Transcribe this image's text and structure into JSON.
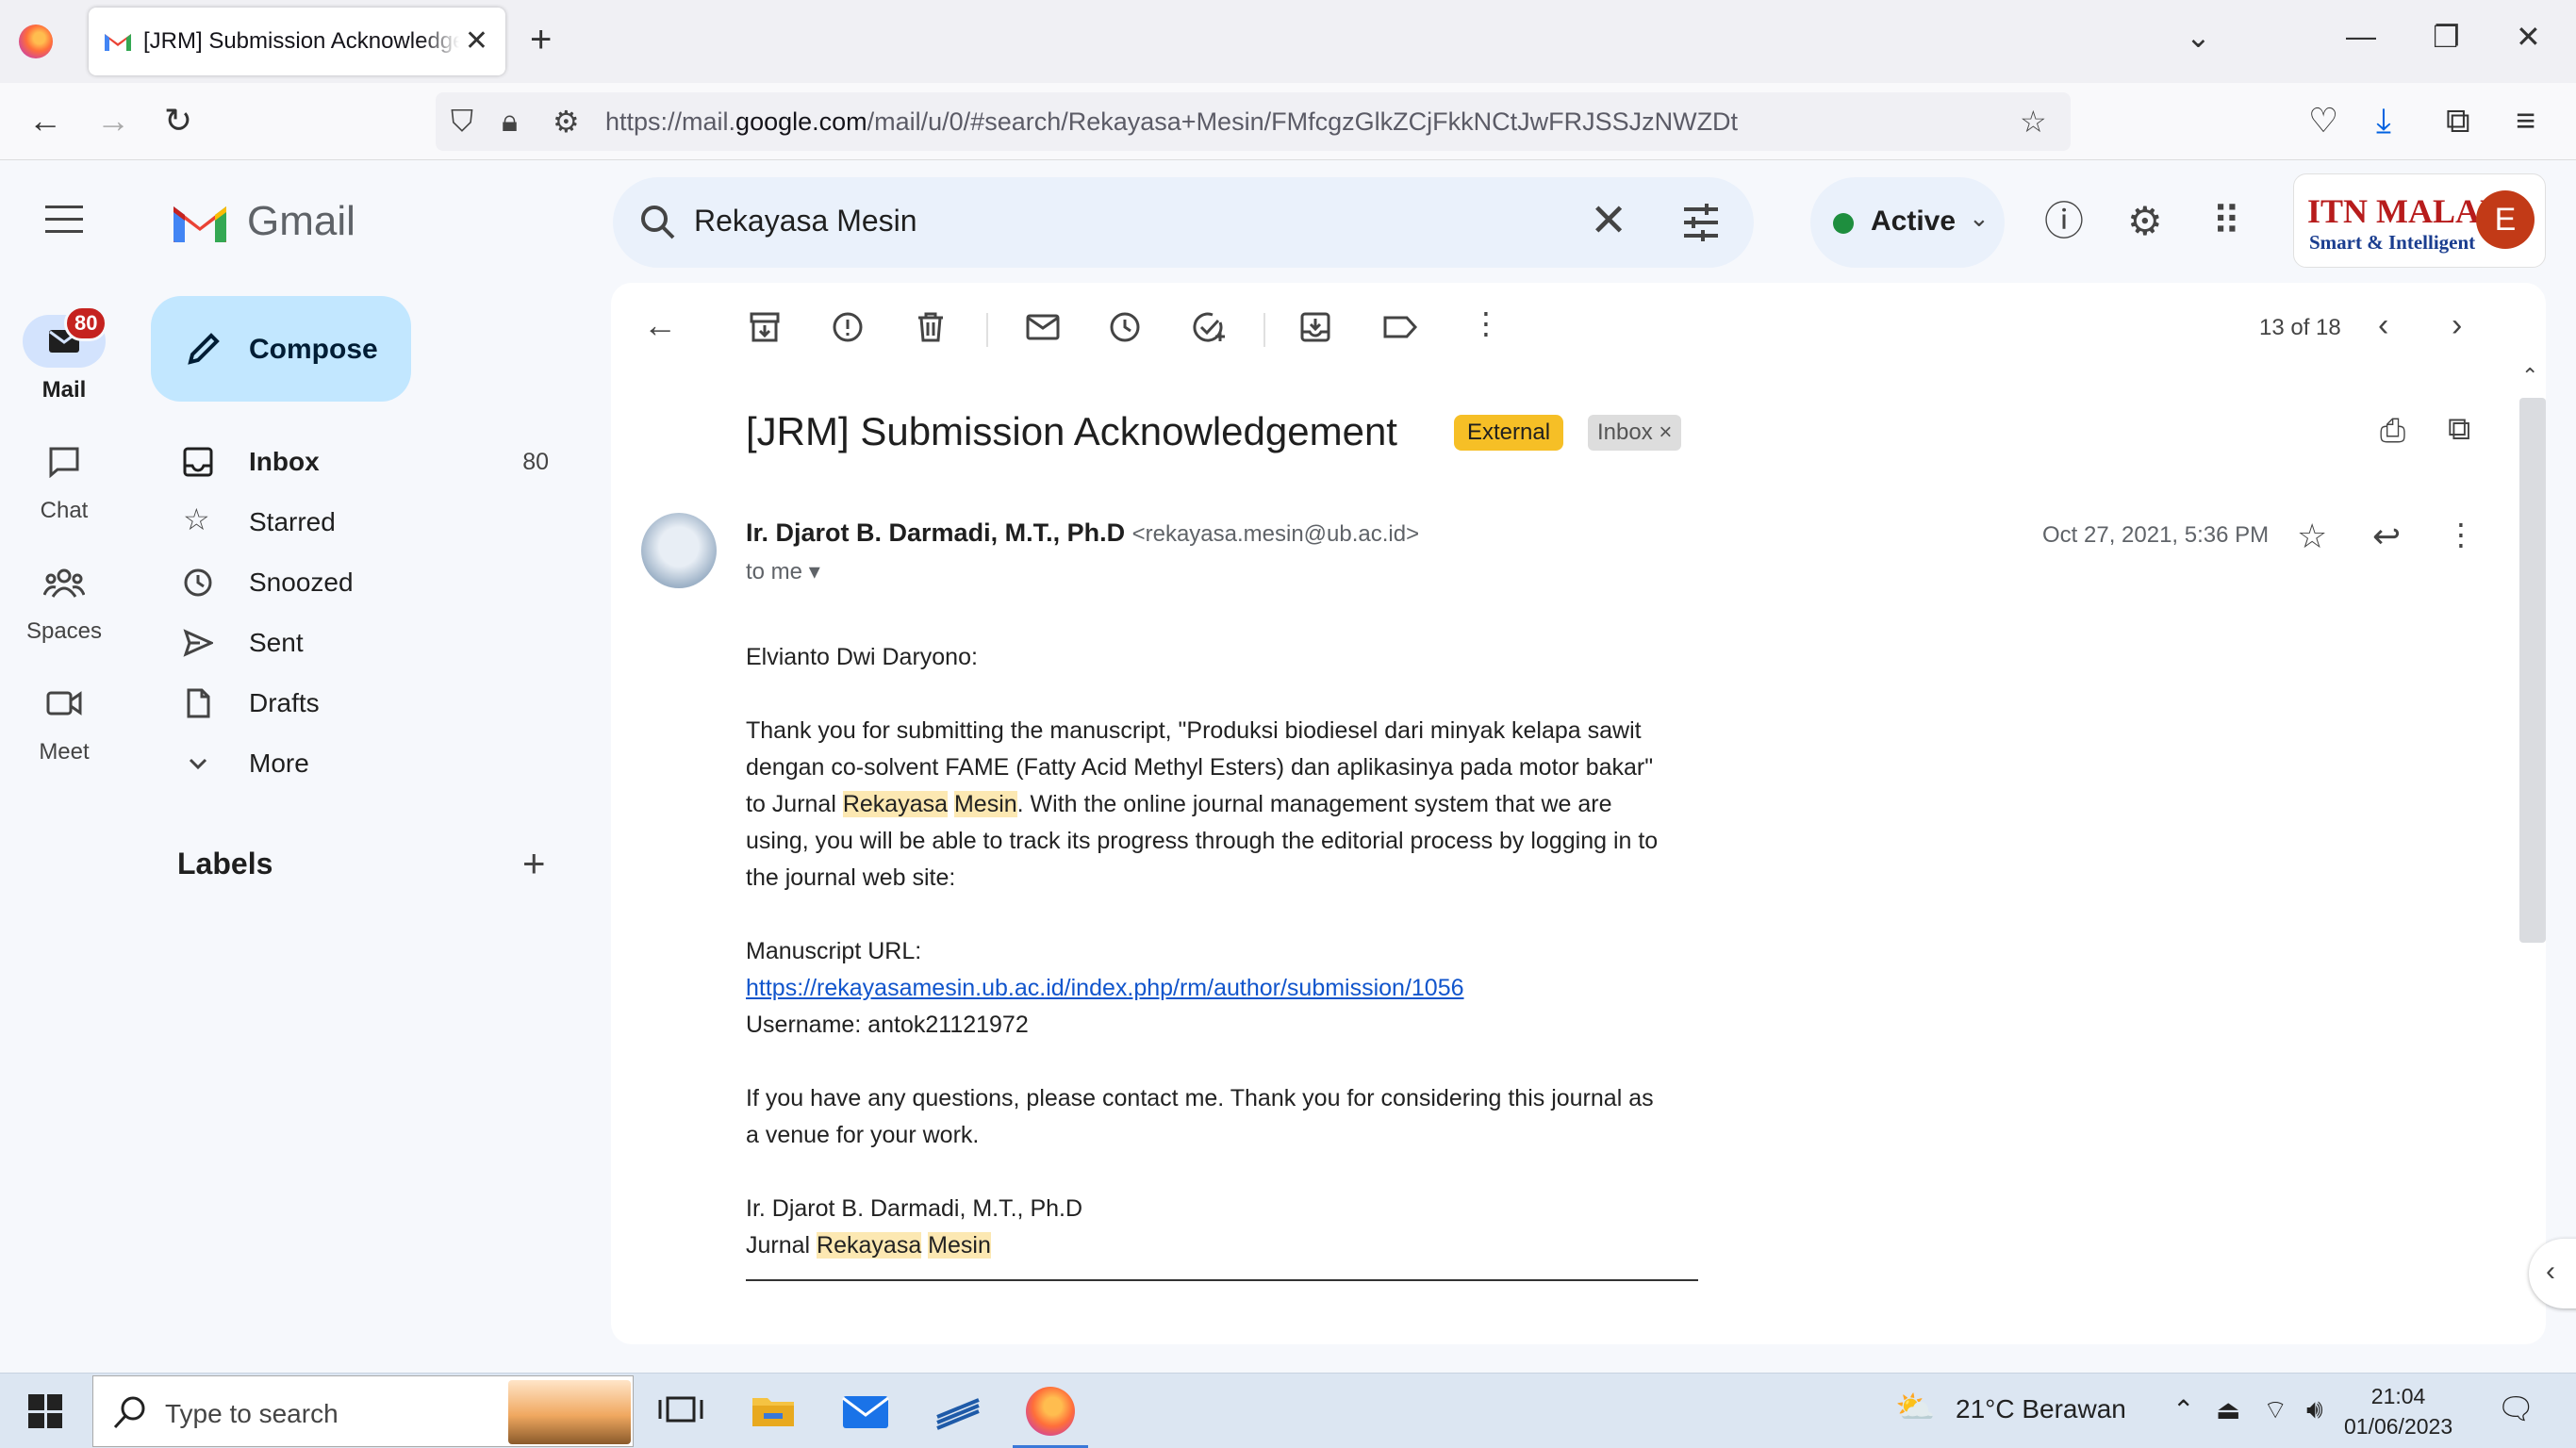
{
  "browser": {
    "tab_title": "[JRM] Submission Acknowledgement",
    "url_prefix": "https://mail.",
    "url_domain": "google.com",
    "url_path": "/mail/u/0/#search/Rekayasa+Mesin/FMfcgzGlkZCjFkkNCtJwFRJSSJzNWZDt"
  },
  "gmail": {
    "app_name": "Gmail",
    "search_query": "Rekayasa Mesin",
    "status_label": "Active",
    "org_name_line1": "ITN MALANG",
    "org_name_line2": "Smart & Intelligent",
    "avatar_letter": "E"
  },
  "rail": {
    "mail_label": "Mail",
    "mail_badge": "80",
    "chat_label": "Chat",
    "spaces_label": "Spaces",
    "meet_label": "Meet"
  },
  "sidebar": {
    "compose_label": "Compose",
    "items": [
      {
        "label": "Inbox",
        "count": "80"
      },
      {
        "label": "Starred",
        "count": ""
      },
      {
        "label": "Snoozed",
        "count": ""
      },
      {
        "label": "Sent",
        "count": ""
      },
      {
        "label": "Drafts",
        "count": ""
      },
      {
        "label": "More",
        "count": ""
      }
    ],
    "labels_heading": "Labels"
  },
  "toolbar": {
    "pager_text": "13 of 18"
  },
  "email": {
    "subject": "[JRM] Submission Acknowledgement",
    "tag_external": "External",
    "tag_inbox": "Inbox",
    "sender_name": "Ir. Djarot B. Darmadi, M.T., Ph.D",
    "sender_email": "<rekayasa.mesin@ub.ac.id>",
    "to_line": "to me",
    "date": "Oct 27, 2021, 5:36 PM",
    "greeting": "Elvianto Dwi Daryono:",
    "para1_before": "Thank you for submitting the manuscript, \"Produksi biodiesel dari minyak kelapa sawit dengan co-solvent FAME (Fatty Acid Methyl Esters) dan aplikasinya pada motor bakar\" to Jurnal ",
    "hl_word1": "Rekayasa",
    "hl_word2": "Mesin",
    "para1_after": ". With the online journal management system that we are using, you will be able to track its progress through the editorial process by logging in to the journal web site:",
    "manuscript_label": "Manuscript URL:",
    "manuscript_url": "https://rekayasamesin.ub.ac.id/index.php/rm/author/submission/1056",
    "username_line": "Username: antok21121972",
    "para2": "If you have any questions, please contact me. Thank you for considering this journal as a venue for your work.",
    "sig_name": "Ir. Djarot B. Darmadi, M.T., Ph.D",
    "sig_journal_prefix": "Jurnal"
  },
  "taskbar": {
    "search_placeholder": "Type to search",
    "weather": "21°C  Berawan",
    "time": "21:04",
    "date": "01/06/2023"
  }
}
